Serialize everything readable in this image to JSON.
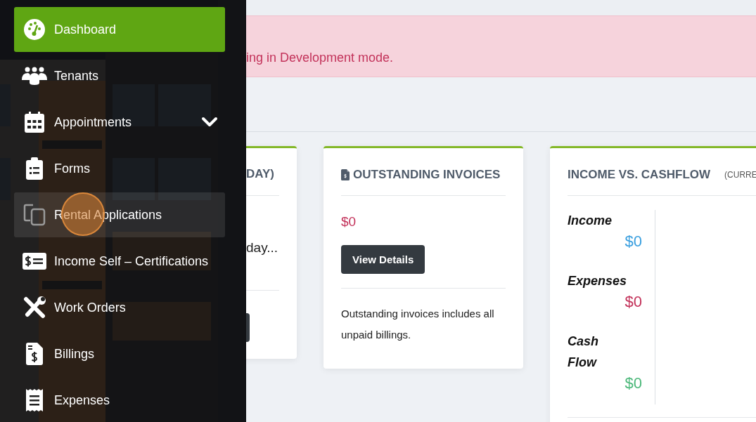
{
  "sidebar": {
    "items": [
      {
        "label": "Dashboard",
        "selected": true,
        "highlighted": false,
        "has_submenu": false,
        "clicked": false
      },
      {
        "label": "Tenants",
        "selected": false,
        "highlighted": false,
        "has_submenu": false,
        "clicked": false
      },
      {
        "label": "Appointments",
        "selected": false,
        "highlighted": false,
        "has_submenu": true,
        "clicked": false
      },
      {
        "label": "Forms",
        "selected": false,
        "highlighted": false,
        "has_submenu": false,
        "clicked": false
      },
      {
        "label": "Rental Applications",
        "selected": false,
        "highlighted": true,
        "has_submenu": false,
        "clicked": true
      },
      {
        "label": "Income Self – Certifications",
        "selected": false,
        "highlighted": false,
        "has_submenu": false,
        "clicked": false
      },
      {
        "label": "Work Orders",
        "selected": false,
        "highlighted": false,
        "has_submenu": false,
        "clicked": false
      },
      {
        "label": "Billings",
        "selected": false,
        "highlighted": false,
        "has_submenu": false,
        "clicked": false
      },
      {
        "label": "Expenses",
        "selected": false,
        "highlighted": false,
        "has_submenu": false,
        "clicked": false
      }
    ]
  },
  "alert": {
    "text": "ing in Development mode."
  },
  "cards": [
    {
      "kind": "partial",
      "title": "DAY)",
      "text": "day..."
    },
    {
      "kind": "invoice",
      "title": "OUTSTANDING INVOICES",
      "amount": "$0",
      "button": "View Details",
      "note": "Outstanding invoices includes all unpaid billings."
    },
    {
      "kind": "cashflow",
      "title": "INCOME VS. CASHFLOW",
      "subtitle": "(CURRE",
      "metrics": [
        {
          "label": "Income",
          "value": "$0",
          "color": "#3a9fdf"
        },
        {
          "label": "Expenses",
          "value": "$0",
          "color": "#c3325a"
        },
        {
          "label": "Cash Flow",
          "value": "$0",
          "color": "#4cb87a"
        }
      ]
    }
  ]
}
